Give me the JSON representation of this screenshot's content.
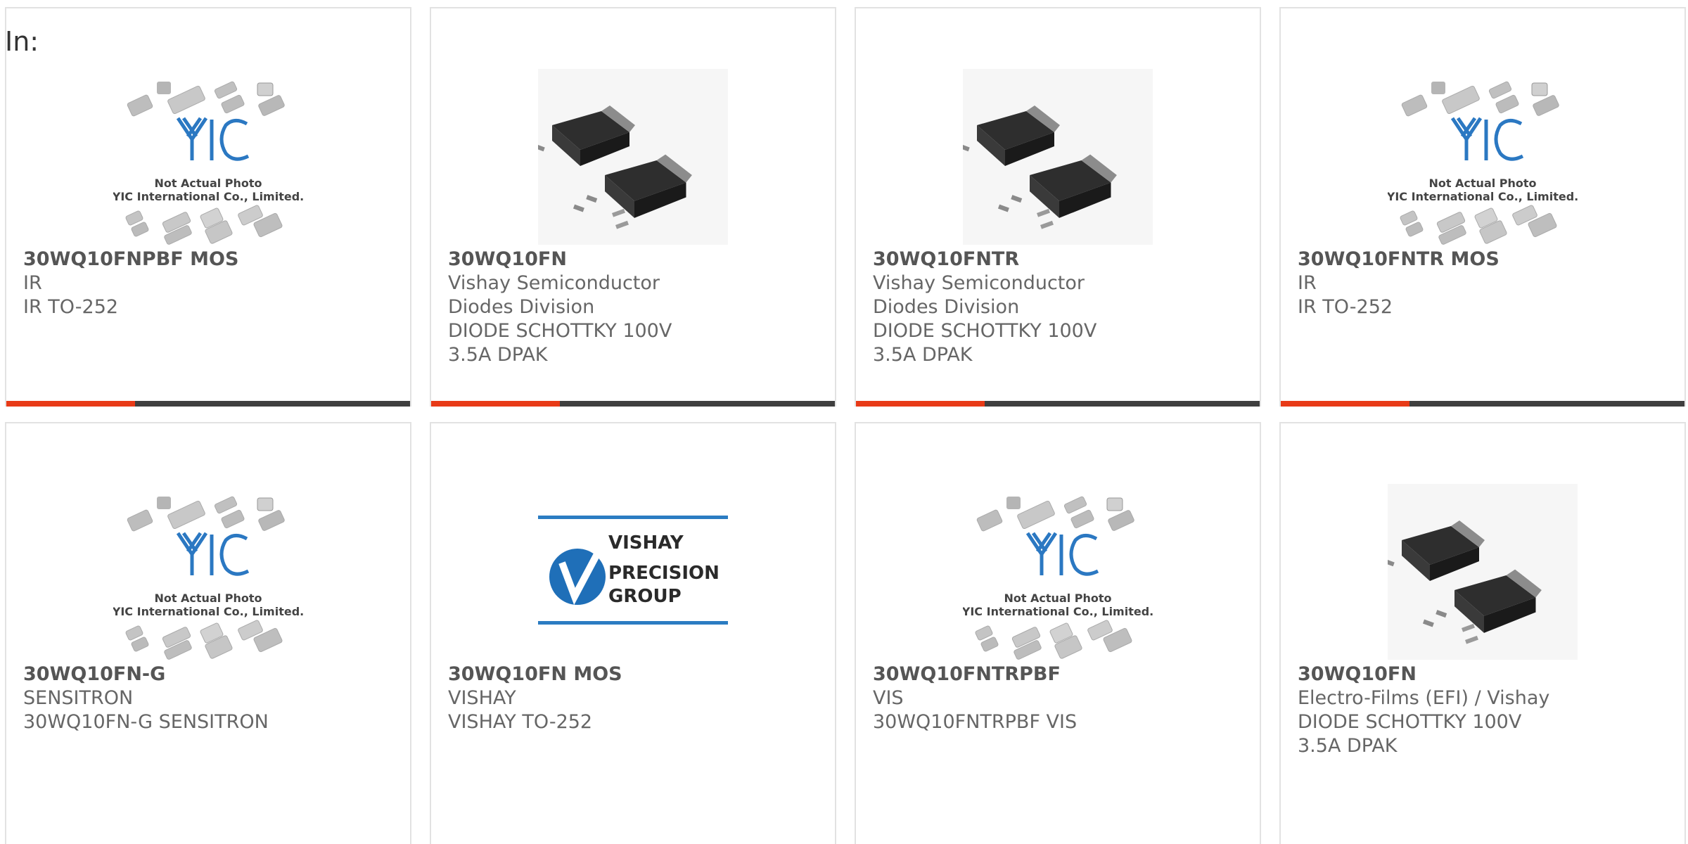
{
  "header": {
    "in_label": "In:"
  },
  "colors": {
    "accent_red": "#e83a17",
    "accent_dark": "#3f3f3f"
  },
  "placeholder": {
    "line1": "Not Actual Photo",
    "line2": "YIC International Co., Limited.",
    "logo_text": "YIC"
  },
  "vishay_logo": {
    "line1": "VISHAY",
    "line2": "PRECISION",
    "line3": "GROUP"
  },
  "products": [
    {
      "part": "30WQ10FNPBF MOS",
      "manufacturer": "IR",
      "description": "IR TO-252",
      "image": "yic-placeholder-icon"
    },
    {
      "part": "30WQ10FN",
      "manufacturer": "Vishay Semiconductor Diodes Division",
      "description": "DIODE SCHOTTKY 100V 3.5A DPAK",
      "image": "dpak-package-icon"
    },
    {
      "part": "30WQ10FNTR",
      "manufacturer": "Vishay Semiconductor Diodes Division",
      "description": "DIODE SCHOTTKY 100V 3.5A DPAK",
      "image": "dpak-package-icon"
    },
    {
      "part": "30WQ10FNTR MOS",
      "manufacturer": "IR",
      "description": "IR TO-252",
      "image": "yic-placeholder-icon"
    },
    {
      "part": "30WQ10FN-G",
      "manufacturer": "SENSITRON",
      "description": "30WQ10FN-G SENSITRON",
      "image": "yic-placeholder-icon"
    },
    {
      "part": "30WQ10FN MOS",
      "manufacturer": "VISHAY",
      "description": "VISHAY TO-252",
      "image": "vishay-logo-icon"
    },
    {
      "part": "30WQ10FNTRPBF",
      "manufacturer": "VIS",
      "description": "30WQ10FNTRPBF VIS",
      "image": "yic-placeholder-icon"
    },
    {
      "part": "30WQ10FN",
      "manufacturer": "Electro-Films (EFI) / Vishay",
      "description": "DIODE SCHOTTKY 100V 3.5A DPAK",
      "image": "dpak-package-icon"
    }
  ]
}
